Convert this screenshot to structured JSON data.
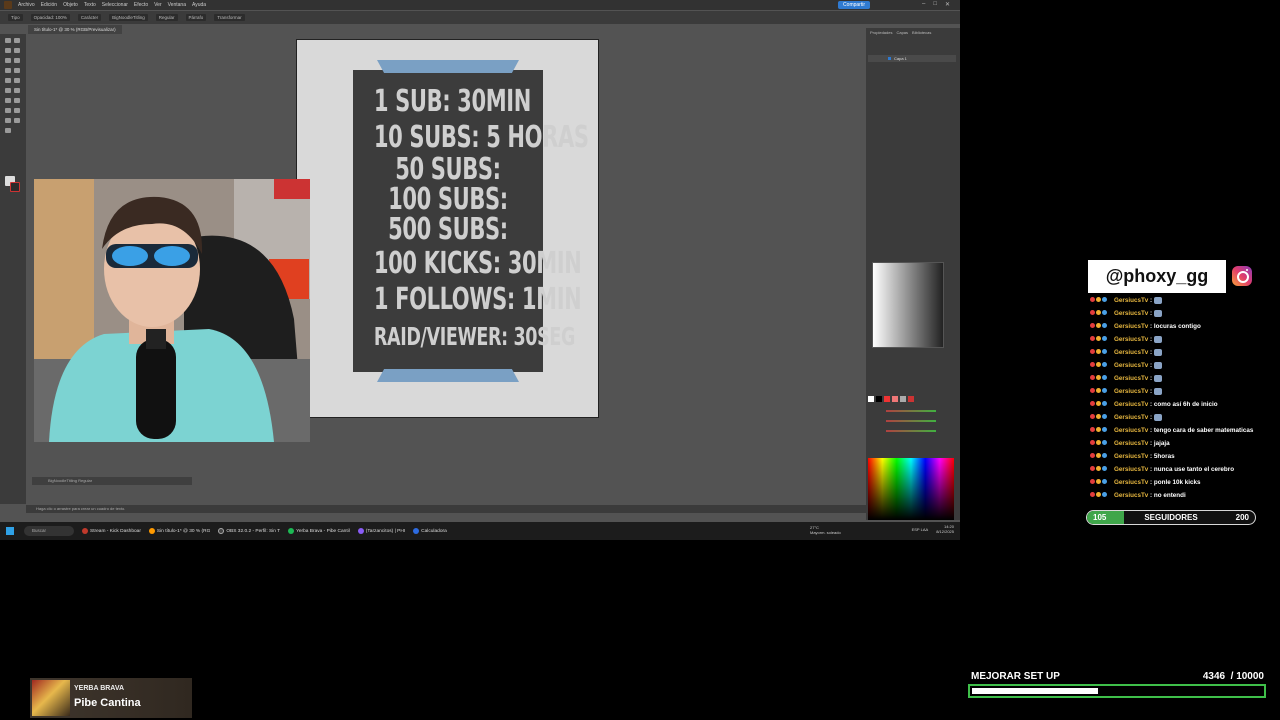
{
  "menubar": {
    "items": [
      "Archivo",
      "Edición",
      "Objeto",
      "Texto",
      "Seleccionar",
      "Efecto",
      "Ver",
      "Ventana",
      "Ayuda"
    ],
    "share_label": "Compartir"
  },
  "controlbar": {
    "items": [
      "Tipo",
      "Opacidad: 100%",
      "Carácter",
      "BigNoodleTitling",
      "Regular",
      "Párrafo",
      "Transformar"
    ]
  },
  "document_tab": "Sin título-1* @ 30 % (RGB/Previsualizar)",
  "poster": {
    "lines": [
      "1 SUB: 30MIN",
      "10 SUBS: 5 HORAS",
      "50 SUBS:",
      "100 SUBS:",
      "500 SUBS:",
      "100 KICKS: 30MIN",
      "1 FOLLOWS: 1MIN",
      "RAID/VIEWER: 30SEG"
    ]
  },
  "props_mini": "BigNoodleTitling    Regular",
  "status_text": "Haga clic o arrastre para crear un cuadro de texto.",
  "right_panels": {
    "tabs": [
      "Propiedades",
      "Capas",
      "Bibliotecas"
    ],
    "layer_name": "Capa 1"
  },
  "taskbar": {
    "search_placeholder": "Buscar",
    "tasks": [
      {
        "label": "Stream - Kick Dashboar",
        "color": "#c0392b"
      },
      {
        "label": "Sin título-1* @ 30 % (RG",
        "color": "#ff9a00"
      },
      {
        "label": "OBS 32.0.2 - Perfil: Sin T",
        "color": "#444444"
      },
      {
        "label": "Yerba Brava - Pibe Cantil",
        "color": "#1db954"
      },
      {
        "label": "(Tarzancitos) | PHI",
        "color": "#8a5cf6"
      },
      {
        "label": "Calculadora",
        "color": "#2d6be0"
      }
    ],
    "weather": [
      "27°C",
      "Mayorm. soleado"
    ],
    "lang": "ESP LAA",
    "time": "14:20",
    "date": "8/12/2025"
  },
  "social": {
    "handle": "@phoxy_gg",
    "icon": "instagram-icon"
  },
  "chat": [
    {
      "user": "GersiucsTv",
      "msg": "",
      "emote": true
    },
    {
      "user": "GersiucsTv",
      "msg": "",
      "emote": true
    },
    {
      "user": "GersiucsTv",
      "msg": "locuras contigo",
      "emote": false
    },
    {
      "user": "GersiucsTv",
      "msg": "",
      "emote": true
    },
    {
      "user": "GersiucsTv",
      "msg": "",
      "emote": true
    },
    {
      "user": "GersiucsTv",
      "msg": "",
      "emote": true
    },
    {
      "user": "GersiucsTv",
      "msg": "",
      "emote": true
    },
    {
      "user": "GersiucsTv",
      "msg": "",
      "emote": true
    },
    {
      "user": "GersiucsTv",
      "msg": "como así 6h de inicio",
      "emote": false
    },
    {
      "user": "GersiucsTv",
      "msg": "",
      "emote": true
    },
    {
      "user": "GersiucsTv",
      "msg": "tengo cara de saber matematicas",
      "emote": false
    },
    {
      "user": "GersiucsTv",
      "msg": "jajaja",
      "emote": false
    },
    {
      "user": "GersiucsTv",
      "msg": "5horas",
      "emote": false
    },
    {
      "user": "GersiucsTv",
      "msg": "nunca use tanto el cerebro",
      "emote": false
    },
    {
      "user": "GersiucsTv",
      "msg": "ponle 10k kicks",
      "emote": false
    },
    {
      "user": "GersiucsTv",
      "msg": "no entendi",
      "emote": false
    }
  ],
  "followers_goal": {
    "start": "105",
    "label": "SEGUIDORES",
    "goal": "200",
    "progress": 0.22
  },
  "setup_goal": {
    "title": "MEJORAR SET UP",
    "count": "4346  / 10000",
    "current": 4346,
    "target": 10000
  },
  "now_playing": {
    "artist": "YERBA BRAVA",
    "title": "Pibe Cantina"
  },
  "colors": {
    "accent_blue": "#7aa0c4",
    "poster_bg": "#3c3c3c",
    "goal_green": "#3fa64a",
    "chat_user": "#e8b840"
  }
}
